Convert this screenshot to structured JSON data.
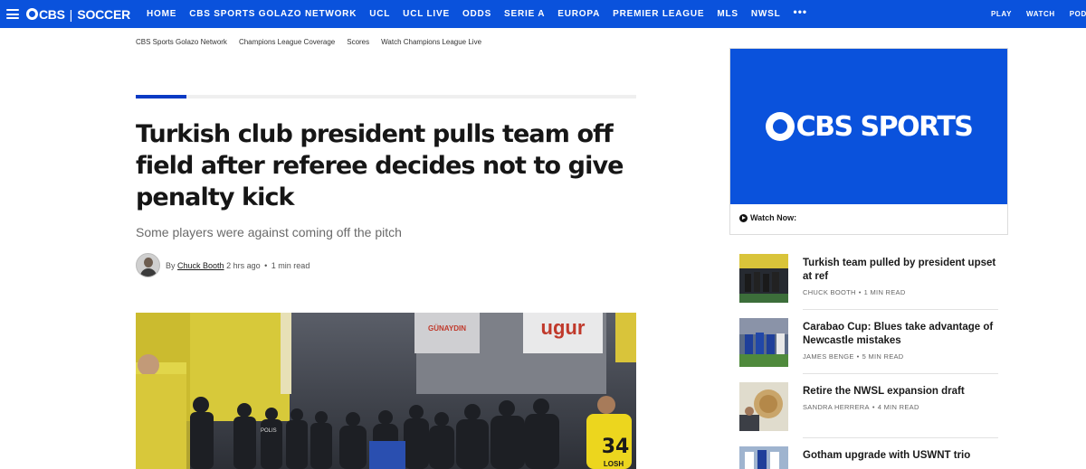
{
  "nav": {
    "logo_brand": "CBS",
    "logo_separator": "|",
    "logo_section": "SOCCER",
    "links": [
      "HOME",
      "CBS SPORTS GOLAZO NETWORK",
      "UCL",
      "UCL LIVE",
      "ODDS",
      "SERIE A",
      "EUROPA",
      "PREMIER LEAGUE",
      "MLS",
      "NWSL"
    ],
    "more": "•••",
    "right_links": [
      "PLAY",
      "WATCH",
      "PODCA"
    ]
  },
  "subnav": [
    "CBS Sports Golazo Network",
    "Champions League Coverage",
    "Scores",
    "Watch Champions League Live"
  ],
  "article": {
    "headline": "Turkish club president pulls team off field after referee decides not to give penalty kick",
    "dek": "Some players were against coming off the pitch",
    "byline_prefix": "By",
    "author": "Chuck Booth",
    "time": "2 hrs ago",
    "dot": "•",
    "read_time": "1 min read",
    "hero_sign_1": "ugur",
    "hero_sign_2": "GÜNAYDIN",
    "hero_jersey": "34",
    "hero_jersey_name": "LOSH",
    "hero_police": "POLIS"
  },
  "video": {
    "logo_text": "CBS SPORTS",
    "watch_now": "Watch Now:"
  },
  "stories": [
    {
      "title": "Turkish team pulled by president upset at ref",
      "author": "CHUCK BOOTH",
      "read": "1 MIN READ"
    },
    {
      "title": "Carabao Cup: Blues take advantage of Newcastle mistakes",
      "author": "JAMES BENGE",
      "read": "5 MIN READ"
    },
    {
      "title": "Retire the NWSL expansion draft",
      "author": "SANDRA HERRERA",
      "read": "4 MIN READ"
    },
    {
      "title": "Gotham upgrade with USWNT trio",
      "author": "",
      "read": ""
    }
  ],
  "colors": {
    "brand_blue": "#0a52dc",
    "accent_blue": "#0a3ac4"
  }
}
